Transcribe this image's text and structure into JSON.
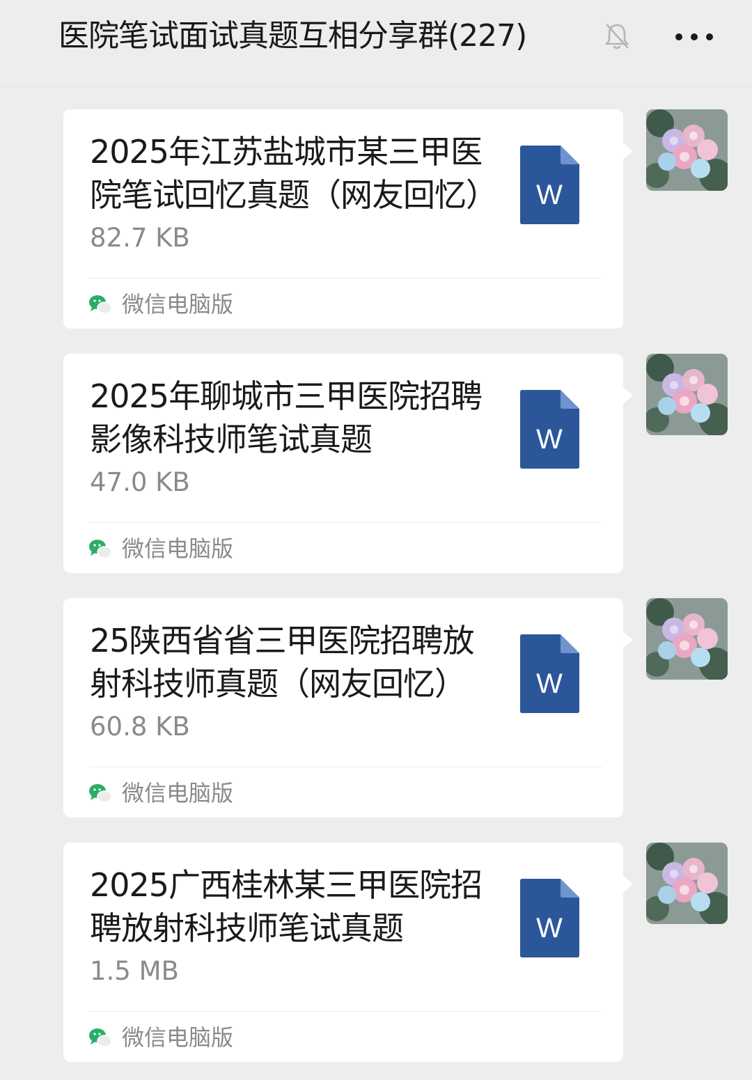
{
  "header": {
    "title": "医院笔试面试真题互相分享群(227)",
    "mute_icon": "bell-slash-icon",
    "more_icon": "more-dots-icon"
  },
  "messages": [
    {
      "file_name": "2025年江苏盐城市某三甲医院笔试回忆真题（网友回忆）",
      "file_size": "82.7 KB",
      "file_type": "word-document-icon",
      "source_icon": "wechat-icon",
      "source_label": "微信电脑版"
    },
    {
      "file_name": "2025年聊城市三甲医院招聘影像科技师笔试真题",
      "file_size": "47.0 KB",
      "file_type": "word-document-icon",
      "source_icon": "wechat-icon",
      "source_label": "微信电脑版"
    },
    {
      "file_name": "25陕西省省三甲医院招聘放射科技师真题（网友回忆）",
      "file_size": "60.8 KB",
      "file_type": "word-document-icon",
      "source_icon": "wechat-icon",
      "source_label": "微信电脑版"
    },
    {
      "file_name": "2025广西桂林某三甲医院招聘放射科技师笔试真题",
      "file_size": "1.5 MB",
      "file_type": "word-document-icon",
      "source_icon": "wechat-icon",
      "source_label": "微信电脑版"
    }
  ],
  "colors": {
    "background": "#ededed",
    "bubble": "#ffffff",
    "word_blue": "#2b579a",
    "wechat_green": "#2aae67"
  }
}
